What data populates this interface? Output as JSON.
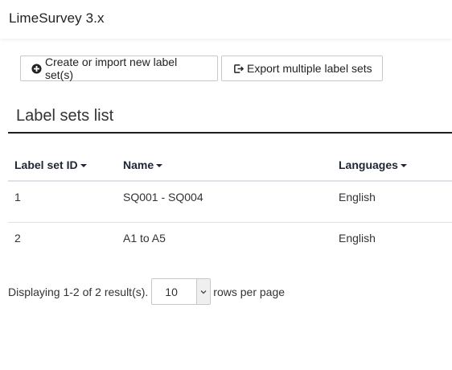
{
  "header": {
    "app_title": "LimeSurvey 3.x"
  },
  "toolbar": {
    "create_label": "Create or import new label set(s)",
    "export_label": "Export multiple label sets",
    "create_icon": "plus-circle-icon",
    "export_icon": "export-icon"
  },
  "section": {
    "title": "Label sets list"
  },
  "table": {
    "columns": [
      {
        "label": "Label set ID",
        "sortable": true
      },
      {
        "label": "Name",
        "sortable": true
      },
      {
        "label": "Languages",
        "sortable": true
      }
    ],
    "rows": [
      {
        "id": "1",
        "name": "SQ001 - SQ004",
        "language": "English"
      },
      {
        "id": "2",
        "name": "A1 to A5",
        "language": "English"
      }
    ]
  },
  "pagination": {
    "summary": "Displaying 1-2 of 2 result(s).",
    "page_size": "10",
    "rows_label": "rows per page"
  },
  "colors": {
    "text": "#212529",
    "rule": "#1f1f1f",
    "border": "#dee2e6"
  }
}
